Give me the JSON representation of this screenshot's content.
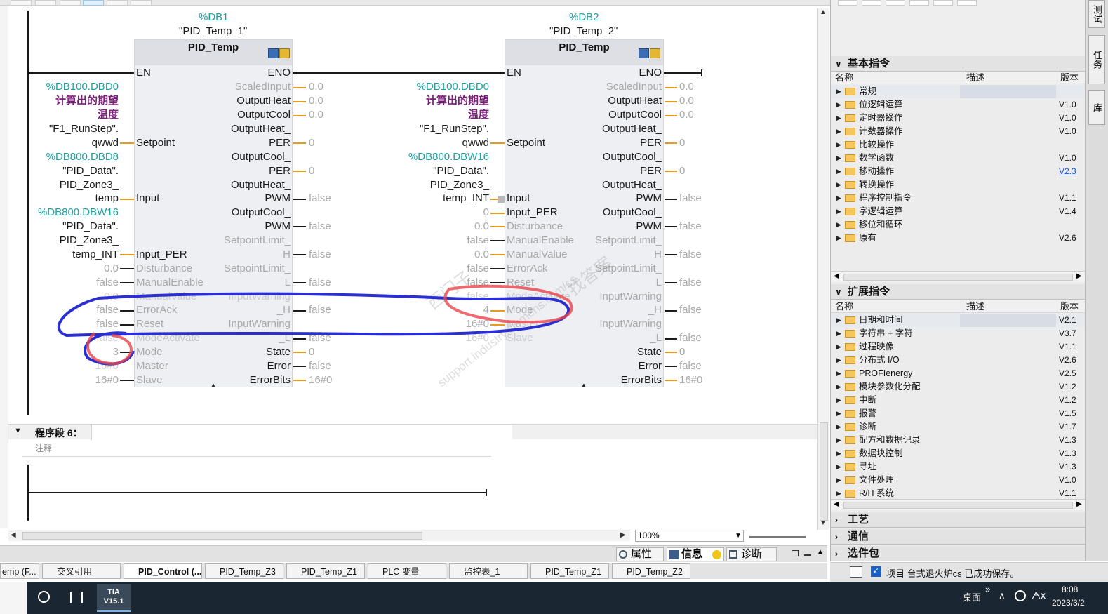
{
  "top_toolbar": {
    "buttons": [
      "",
      "",
      "",
      "",
      "",
      ""
    ]
  },
  "blocks": [
    {
      "db": "%DB1",
      "instance": "\"PID_Temp_1\"",
      "type": "PID_Temp",
      "en": "EN",
      "eno": "ENO",
      "inputs": [
        {
          "name": "Setpoint",
          "value_lines": [
            "%DB100.DBD0",
            "计算出的期望",
            "温度",
            "\"F1_RunStep\".",
            "qwwd"
          ]
        },
        {
          "name": "Input",
          "value_lines": [
            "%DB800.DBD8",
            "\"PID_Data\".",
            "PID_Zone3_",
            "temp"
          ]
        },
        {
          "name": "Input_PER",
          "value_lines": [
            "%DB800.DBW16",
            "\"PID_Data\".",
            "PID_Zone3_",
            "temp_INT"
          ]
        },
        {
          "name": "Disturbance",
          "value": "0.0"
        },
        {
          "name": "ManualEnable",
          "value": "false"
        },
        {
          "name": "ManualValue",
          "value": "0.0"
        },
        {
          "name": "ErrorAck",
          "value": "false"
        },
        {
          "name": "Reset",
          "value": "false"
        },
        {
          "name": "ModeActivate",
          "value": "false"
        },
        {
          "name": "Mode",
          "value": "3"
        },
        {
          "name": "Master",
          "value": "16#0"
        },
        {
          "name": "Slave",
          "value": "16#0"
        }
      ],
      "outputs": [
        {
          "name": "ScaledInput",
          "value": "0.0"
        },
        {
          "name": "OutputHeat",
          "value": "0.0"
        },
        {
          "name": "OutputCool",
          "value": "0.0"
        },
        {
          "name_lines": [
            "OutputHeat_",
            "PER"
          ],
          "value": "0"
        },
        {
          "name_lines": [
            "OutputCool_",
            "PER"
          ],
          "value": "0"
        },
        {
          "name_lines": [
            "OutputHeat_",
            "PWM"
          ],
          "value": "false"
        },
        {
          "name_lines": [
            "OutputCool_",
            "PWM"
          ],
          "value": "false"
        },
        {
          "name_lines": [
            "SetpointLimit_",
            "H"
          ],
          "value": "false"
        },
        {
          "name_lines": [
            "SetpointLimit_",
            "L"
          ],
          "value": "false"
        },
        {
          "name_lines": [
            "InputWarning",
            "_H"
          ],
          "value": "false"
        },
        {
          "name_lines": [
            "InputWarning",
            "_L"
          ],
          "value": "false"
        },
        {
          "name": "State",
          "value": "0"
        },
        {
          "name": "Error",
          "value": "false"
        },
        {
          "name": "ErrorBits",
          "value": "16#0"
        }
      ]
    },
    {
      "db": "%DB2",
      "instance": "\"PID_Temp_2\"",
      "type": "PID_Temp",
      "en": "EN",
      "eno": "ENO",
      "inputs": [
        {
          "name": "Setpoint",
          "value_lines": [
            "%DB100.DBD0",
            "计算出的期望",
            "温度",
            "\"F1_RunStep\".",
            "qwwd"
          ]
        },
        {
          "name": "Input",
          "value_lines": [
            "%DB800.DBW16",
            "\"PID_Data\".",
            "PID_Zone3_",
            "temp_INT"
          ]
        },
        {
          "name": "Input_PER",
          "value": "0"
        },
        {
          "name": "Disturbance",
          "value": "0.0"
        },
        {
          "name": "ManualEnable",
          "value": "false"
        },
        {
          "name": "ManualValue",
          "value": "0.0"
        },
        {
          "name": "ErrorAck",
          "value": "false"
        },
        {
          "name": "Reset",
          "value": "false"
        },
        {
          "name": "ModeActivate",
          "value": "false"
        },
        {
          "name": "Mode",
          "value": "4"
        },
        {
          "name": "Master",
          "value": "16#0"
        },
        {
          "name": "Slave",
          "value": "16#0"
        }
      ],
      "outputs": [
        {
          "name": "ScaledInput",
          "value": "0.0"
        },
        {
          "name": "OutputHeat",
          "value": "0.0"
        },
        {
          "name": "OutputCool",
          "value": "0.0"
        },
        {
          "name_lines": [
            "OutputHeat_",
            "PER"
          ],
          "value": "0"
        },
        {
          "name_lines": [
            "OutputCool_",
            "PER"
          ],
          "value": "0"
        },
        {
          "name_lines": [
            "OutputHeat_",
            "PWM"
          ],
          "value": "false"
        },
        {
          "name_lines": [
            "OutputCool_",
            "PWM"
          ],
          "value": "false"
        },
        {
          "name_lines": [
            "SetpointLimit_",
            "H"
          ],
          "value": "false"
        },
        {
          "name_lines": [
            "SetpointLimit_",
            "L"
          ],
          "value": "false"
        },
        {
          "name_lines": [
            "InputWarning",
            "_H"
          ],
          "value": "false"
        },
        {
          "name_lines": [
            "InputWarning",
            "_L"
          ],
          "value": "false"
        },
        {
          "name": "State",
          "value": "0"
        },
        {
          "name": "Error",
          "value": "false"
        },
        {
          "name": "ErrorBits",
          "value": "16#0"
        }
      ]
    }
  ],
  "network6": {
    "title": "程序段 6：",
    "comment": "注释"
  },
  "bottom_bar": {
    "zoom": "100%",
    "properties": "属性",
    "info": "信息",
    "diagnostics": "诊断"
  },
  "side_tabs": [
    "测试",
    "任务",
    "库"
  ],
  "basic_instructions": {
    "title": "基本指令",
    "col_name": "名称",
    "col_desc": "描述",
    "col_ver": "版本",
    "rows": [
      {
        "name": "常规",
        "ver": ""
      },
      {
        "name": "位逻辑运算",
        "ver": "V1.0"
      },
      {
        "name": "定时器操作",
        "ver": "V1.0"
      },
      {
        "name": "计数器操作",
        "ver": "V1.0"
      },
      {
        "name": "比较操作",
        "ver": ""
      },
      {
        "name": "数学函数",
        "ver": "V1.0"
      },
      {
        "name": "移动操作",
        "ver": "V2.3"
      },
      {
        "name": "转换操作",
        "ver": ""
      },
      {
        "name": "程序控制指令",
        "ver": "V1.1"
      },
      {
        "name": "字逻辑运算",
        "ver": "V1.4"
      },
      {
        "name": "移位和循环",
        "ver": ""
      },
      {
        "name": "原有",
        "ver": "V2.6"
      }
    ]
  },
  "extended_instructions": {
    "title": "扩展指令",
    "col_name": "名称",
    "col_desc": "描述",
    "col_ver": "版本",
    "rows": [
      {
        "name": "日期和时间",
        "ver": "V2.1"
      },
      {
        "name": "字符串 + 字符",
        "ver": "V3.7"
      },
      {
        "name": "过程映像",
        "ver": "V1.1"
      },
      {
        "name": "分布式 I/O",
        "ver": "V2.6"
      },
      {
        "name": "PROFIenergy",
        "ver": "V2.5"
      },
      {
        "name": "模块参数化分配",
        "ver": "V1.2"
      },
      {
        "name": "中断",
        "ver": "V1.2"
      },
      {
        "name": "报警",
        "ver": "V1.5"
      },
      {
        "name": "诊断",
        "ver": "V1.7"
      },
      {
        "name": "配方和数据记录",
        "ver": "V1.3"
      },
      {
        "name": "数据块控制",
        "ver": "V1.3"
      },
      {
        "name": "寻址",
        "ver": "V1.3"
      },
      {
        "name": "文件处理",
        "ver": "V1.0"
      },
      {
        "name": "R/H 系统",
        "ver": "V1.1"
      }
    ]
  },
  "collapsed_sections": [
    "工艺",
    "通信",
    "选件包"
  ],
  "editor_tabs": [
    "emp (F...",
    "交叉引用",
    "PID_Control (...",
    "PID_Temp_Z3",
    "PID_Temp_Z1",
    "PLC 变量",
    "监控表_1",
    "PID_Temp_Z1",
    "PID_Temp_Z2"
  ],
  "status_message": "项目 台式退火炉cs 已成功保存。",
  "taskbar": {
    "tia_label": "TIA V15.1",
    "desktop": "桌面",
    "chevron": "»",
    "time": "8:08",
    "date": "2023/3/2"
  },
  "watermark": {
    "line1": "西门子",
    "line2": "找答案",
    "line3": "support.industry.siemens.com/cs"
  },
  "colors": {
    "teal": "#1aa1a1",
    "purple": "#7a1e79",
    "orange_pin": "#e89a1a",
    "annotation_blue": "#2b2fd1",
    "annotation_red": "#e8444a"
  }
}
